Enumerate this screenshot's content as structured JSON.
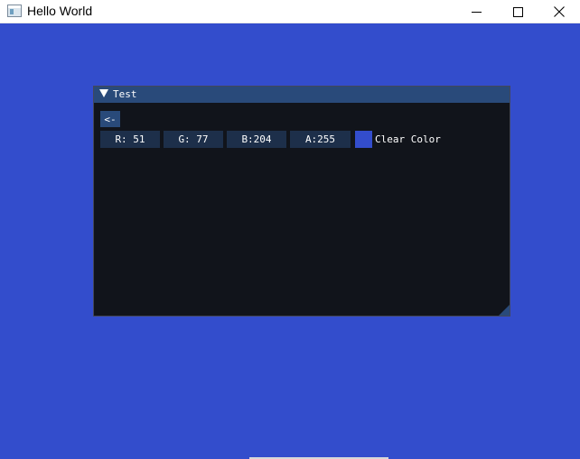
{
  "window": {
    "title": "Hello World",
    "controls": [
      "minimize-icon",
      "maximize-icon",
      "close-icon"
    ]
  },
  "clear_color_hex": "#334dcc",
  "imgui_window": {
    "title": "Test",
    "back_button_label": "<-",
    "color_components": [
      {
        "label": "R: 51"
      },
      {
        "label": "G: 77"
      },
      {
        "label": "B:204"
      },
      {
        "label": "A:255"
      }
    ],
    "color_label": "Clear Color"
  },
  "colors": {
    "title_bg": "#294a7a",
    "panel_bg": "#11141b",
    "frame_bg": "#1d2f4a"
  }
}
